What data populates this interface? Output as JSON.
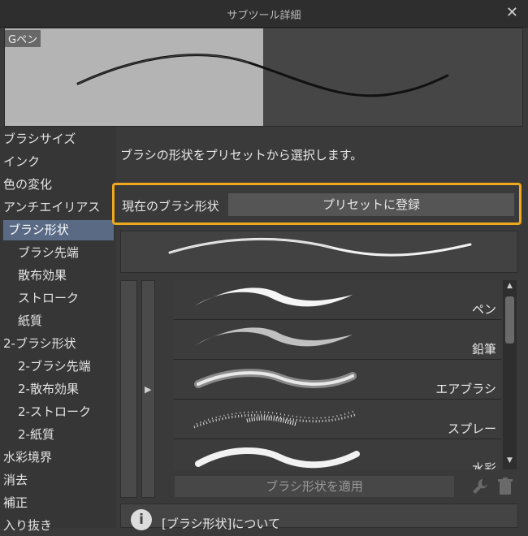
{
  "window": {
    "title": "サブツール詳細"
  },
  "preview": {
    "tool_name": "Gペン"
  },
  "sidebar": {
    "items": [
      {
        "label": "ブラシサイズ"
      },
      {
        "label": "インク"
      },
      {
        "label": "色の変化"
      },
      {
        "label": "アンチエイリアス"
      },
      {
        "label": "ブラシ形状"
      },
      {
        "label": "ブラシ先端"
      },
      {
        "label": "散布効果"
      },
      {
        "label": "ストローク"
      },
      {
        "label": "紙質"
      },
      {
        "label": "2-ブラシ形状"
      },
      {
        "label": "2-ブラシ先端"
      },
      {
        "label": "2-散布効果"
      },
      {
        "label": "2-ストローク"
      },
      {
        "label": "2-紙質"
      },
      {
        "label": "水彩境界"
      },
      {
        "label": "消去"
      },
      {
        "label": "補正"
      },
      {
        "label": "入り抜き"
      }
    ],
    "active_item": "ブラシ形状"
  },
  "main": {
    "description": "ブラシの形状をプリセットから選択します。",
    "current_shape_label": "現在のブラシ形状",
    "register_button": "プリセットに登録",
    "presets": [
      {
        "name": "ペン"
      },
      {
        "name": "鉛筆"
      },
      {
        "name": "エアブラシ"
      },
      {
        "name": "スプレー"
      },
      {
        "name": "水彩"
      }
    ],
    "apply_button": "ブラシ形状を適用",
    "info_text": "[ブラシ形状]について"
  },
  "colors": {
    "highlight": "#f0a81c",
    "active_item": "#5a6a85"
  }
}
